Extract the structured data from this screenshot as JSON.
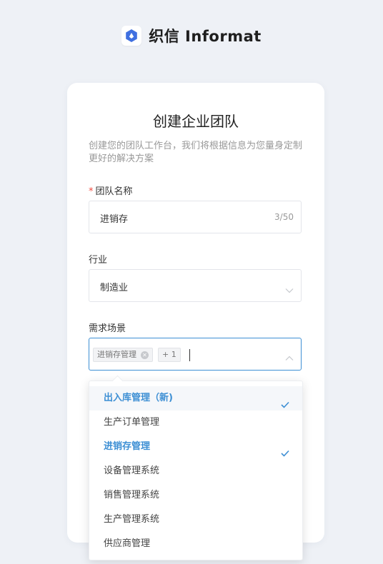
{
  "brand": {
    "logo_text": "织信 Informat"
  },
  "card": {
    "title": "创建企业团队",
    "subtitle": "创建您的团队工作台，我们将根据信息为您量身定制更好的解决方案"
  },
  "form": {
    "team_name": {
      "required_mark": "*",
      "label": "团队名称",
      "value": "进销存",
      "counter": "3/50"
    },
    "industry": {
      "label": "行业",
      "value": "制造业"
    },
    "scenario": {
      "label": "需求场景",
      "tags": [
        "进销存管理"
      ],
      "more_count": "+ 1"
    }
  },
  "dropdown": {
    "options": [
      {
        "label": "出入库管理（新)",
        "selected": true
      },
      {
        "label": "生产订单管理",
        "selected": false
      },
      {
        "label": "进销存管理",
        "selected": true
      },
      {
        "label": "设备管理系统",
        "selected": false
      },
      {
        "label": "销售管理系统",
        "selected": false
      },
      {
        "label": "生产管理系统",
        "selected": false
      },
      {
        "label": "供应商管理",
        "selected": false
      }
    ]
  },
  "colors": {
    "accent": "#3d8fd4",
    "required": "#f04a3f",
    "brand_icon": "#3f6fe0"
  }
}
